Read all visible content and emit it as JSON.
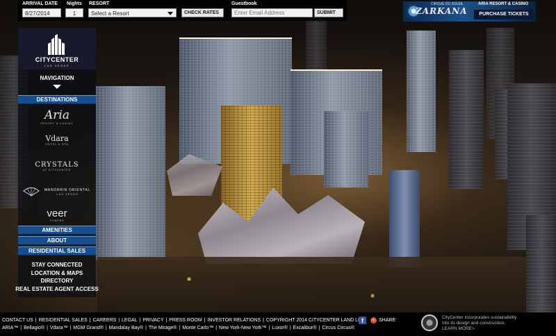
{
  "search": {
    "arrival_label": "ARRIVAL DATE",
    "arrival_value": "8/27/2014",
    "nights_label": "Nights",
    "nights_value": "1",
    "resort_label": "RESORT",
    "resort_value": "Select a Resort",
    "check_rates": "CHECK RATES"
  },
  "guestbook": {
    "label": "Guestbook",
    "placeholder": "Enter Email Address",
    "submit": "SUBMIT"
  },
  "ad": {
    "brand": "CIRQUE DU SOLEIL",
    "show": "ZARKANA",
    "venue": "ARIA RESORT & CASINO",
    "cta": "PURCHASE TICKETS"
  },
  "logo": {
    "name": "CITYCENTER",
    "subtitle": "LAS VEGAS"
  },
  "nav": {
    "heading": "NAVIGATION",
    "destinations": "DESTINATIONS",
    "dest_logos": [
      {
        "name": "Aria",
        "sub": "RESORT & CASINO"
      },
      {
        "name": "Vdara",
        "sub": "HOTEL & SPA"
      },
      {
        "name": "CRYSTALS",
        "sub": "AT CITYCENTER"
      },
      {
        "name": "MANDARIN ORIENTAL",
        "sub": "LAS VEGAS"
      },
      {
        "name": "veer",
        "sub": "TOWERS"
      }
    ],
    "amenities": "AMENITIES",
    "about": "ABOUT",
    "residential_sales": "RESIDENTIAL SALES",
    "stay_connected": "STAY CONNECTED",
    "location_maps": "LOCATION & MAPS",
    "directory": "DIRECTORY",
    "real_estate": "REAL ESTATE AGENT ACCESS"
  },
  "footer": {
    "links": [
      "CONTACT US",
      "RESIDENTIAL SALES",
      "CAREERS",
      "LEGAL",
      "PRIVACY",
      "PRESS ROOM",
      "INVESTOR RELATIONS"
    ],
    "copyright": "COPYRIGHT 2014 CITYCENTER LAND LLC",
    "brands": [
      "ARIA™",
      "Bellagio®",
      "Vdara™",
      "MGM Grand®",
      "Mandalay Bay®",
      "The Mirage®",
      "Monte Carlo™",
      "New York-New York™",
      "Luxor®",
      "Excalibur®",
      "Circus Circus®"
    ],
    "facebook_glyph": "f",
    "share": "SHARE",
    "sustainability_1": "CityCenter incorporates sustainability",
    "sustainability_2": "into its design and construction.",
    "learn_more": "LEARN MORE>"
  },
  "colors": {
    "nav_bar": "#174d8c",
    "footer_bg": "#000000",
    "topbar_bg": "#000000",
    "ad_bg": "#1f4f86"
  }
}
